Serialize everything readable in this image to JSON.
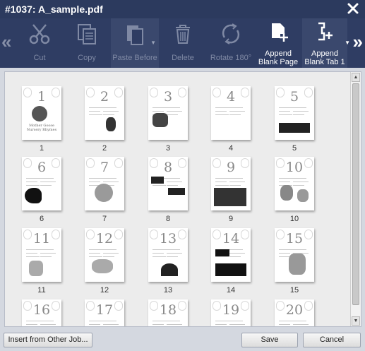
{
  "window": {
    "title": "#1037: A_sample.pdf"
  },
  "toolbar": {
    "cut": "Cut",
    "copy": "Copy",
    "paste_before": "Paste Before",
    "delete": "Delete",
    "rotate": "Rotate 180°",
    "append_blank_page": "Append\nBlank Page",
    "append_blank_tab": "Append\nBlank Tab 1"
  },
  "pages": [
    {
      "num": "1",
      "caption": "1",
      "cover": "Mother Goose\nNursery Rhymes"
    },
    {
      "num": "2",
      "caption": "2"
    },
    {
      "num": "3",
      "caption": "3"
    },
    {
      "num": "4",
      "caption": "4"
    },
    {
      "num": "5",
      "caption": "5"
    },
    {
      "num": "6",
      "caption": "6"
    },
    {
      "num": "7",
      "caption": "7"
    },
    {
      "num": "8",
      "caption": "8"
    },
    {
      "num": "9",
      "caption": "9"
    },
    {
      "num": "10",
      "caption": "10"
    },
    {
      "num": "11",
      "caption": "11"
    },
    {
      "num": "12",
      "caption": "12"
    },
    {
      "num": "13",
      "caption": "13"
    },
    {
      "num": "14",
      "caption": "14"
    },
    {
      "num": "15",
      "caption": "15"
    },
    {
      "num": "16",
      "caption": ""
    },
    {
      "num": "17",
      "caption": ""
    },
    {
      "num": "18",
      "caption": ""
    },
    {
      "num": "19",
      "caption": ""
    },
    {
      "num": "20",
      "caption": ""
    }
  ],
  "footer": {
    "insert": "Insert from Other Job...",
    "save": "Save",
    "cancel": "Cancel"
  }
}
